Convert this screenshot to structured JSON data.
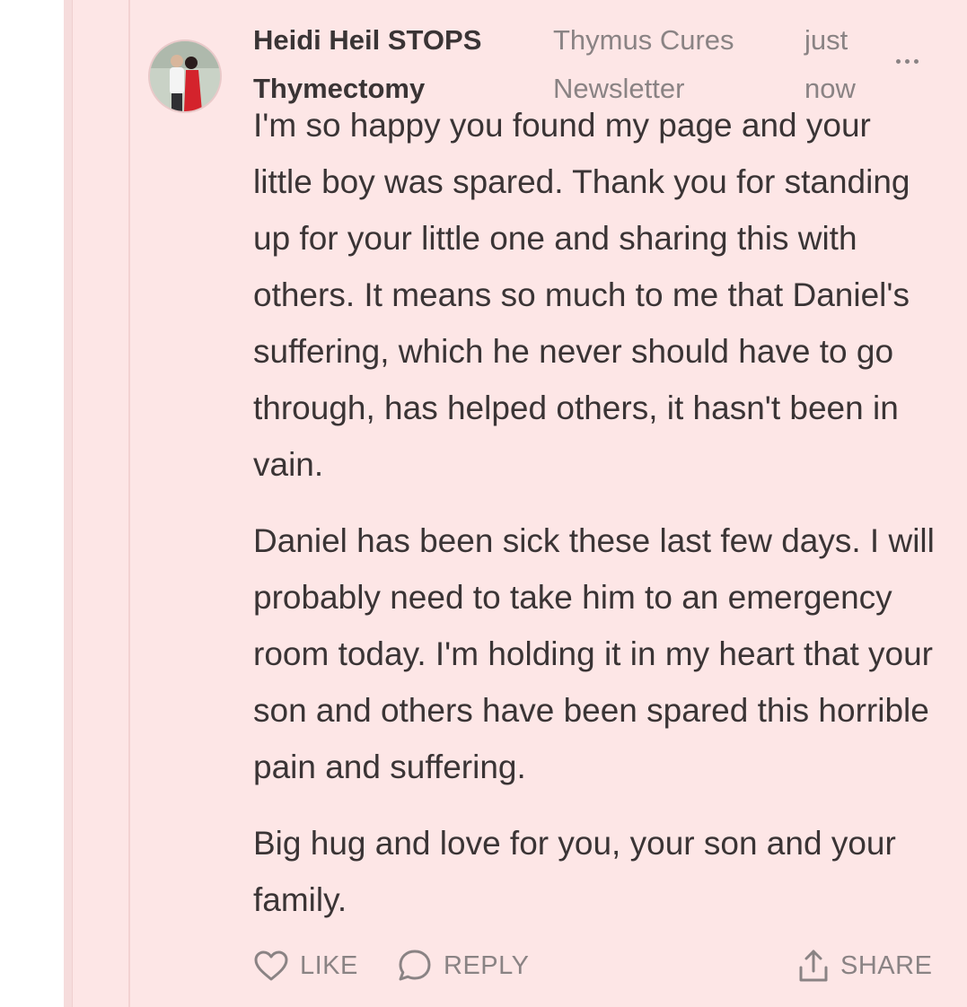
{
  "comment": {
    "author": "Heidi Heil STOPS Thymectomy",
    "publication": "Thymus Cures Newsletter",
    "time": "just now",
    "paragraphs": [
      "I'm so happy you found my page and your little boy was spared. Thank you for standing up for your little one and sharing this with others. It means so much to me that Daniel's suffering, which he never should have to go through, has helped others, it hasn't been in vain.",
      "Daniel has been sick these last few days. I will probably need to take him to an emergency room today. I'm holding it in my heart that your son and others have been spared this horrible pain and suffering.",
      "Big hug and love for you, your son and your family."
    ]
  },
  "actions": {
    "like_label": "LIKE",
    "reply_label": "REPLY",
    "share_label": "SHARE"
  },
  "icons": {
    "like": "heart-icon",
    "reply": "speech-bubble-icon",
    "share": "share-upload-icon",
    "more": "more-dots-icon"
  },
  "colors": {
    "background": "#fde6e6",
    "text": "#3a3435",
    "muted": "#8a8384"
  }
}
